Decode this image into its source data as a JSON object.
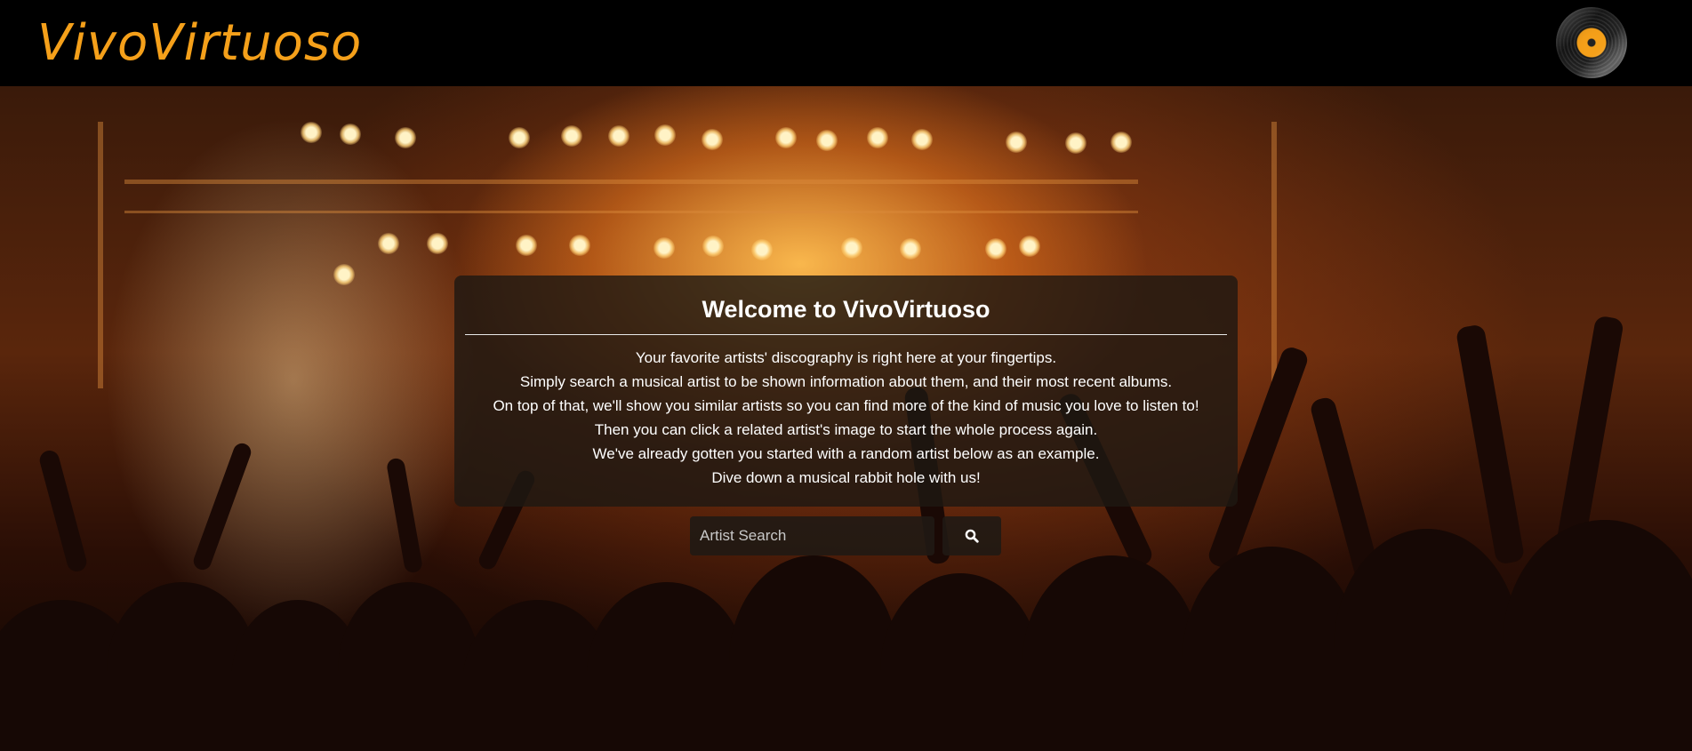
{
  "navbar": {
    "brand": "VivoVirtuoso",
    "logo_icon": "vinyl-record-icon"
  },
  "welcome": {
    "title": "Welcome to VivoVirtuoso",
    "lines": [
      "Your favorite artists' discography is right here at your fingertips.",
      "Simply search a musical artist to be shown information about them, and their most recent albums.",
      "On top of that, we'll show you similar artists so you can find more of the kind of music you love to listen to!",
      "Then you can click a related artist's image to start the whole process again.",
      "We've already gotten you started with a random artist below as an example.",
      "Dive down a musical rabbit hole with us!"
    ]
  },
  "search": {
    "placeholder": "Artist Search",
    "value": "",
    "button_icon": "search-icon"
  },
  "colors": {
    "brand": "#f5a01a",
    "navbar_bg": "#000000",
    "panel_bg": "rgba(30,24,18,0.82)"
  }
}
